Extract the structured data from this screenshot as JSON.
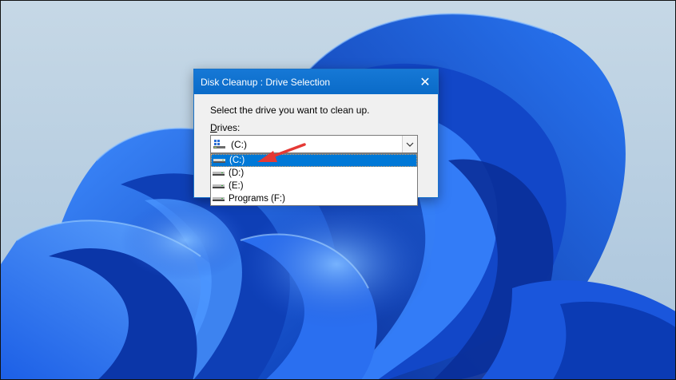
{
  "dialog": {
    "title": "Disk Cleanup : Drive Selection",
    "close_glyph": "✕",
    "instruction": "Select the drive you want to clean up.",
    "drives_label_mnemonic": "D",
    "drives_label_rest": "rives:"
  },
  "combo": {
    "selected_value": "(C:)",
    "icon": "windows-drive-icon",
    "arrow_icon": "chevron-down-icon"
  },
  "dropdown": {
    "items": [
      {
        "label": "(C:)",
        "icon": "hard-drive-icon",
        "selected": true
      },
      {
        "label": "(D:)",
        "icon": "hard-drive-icon",
        "selected": false
      },
      {
        "label": "(E:)",
        "icon": "hard-drive-icon",
        "selected": false
      },
      {
        "label": "Programs (F:)",
        "icon": "hard-drive-icon",
        "selected": false
      }
    ]
  },
  "colors": {
    "titlebar": "#0a6fcf",
    "selection": "#0078d7",
    "annotation_arrow": "#e53935",
    "wallpaper_blue": "#1f5ee0"
  }
}
